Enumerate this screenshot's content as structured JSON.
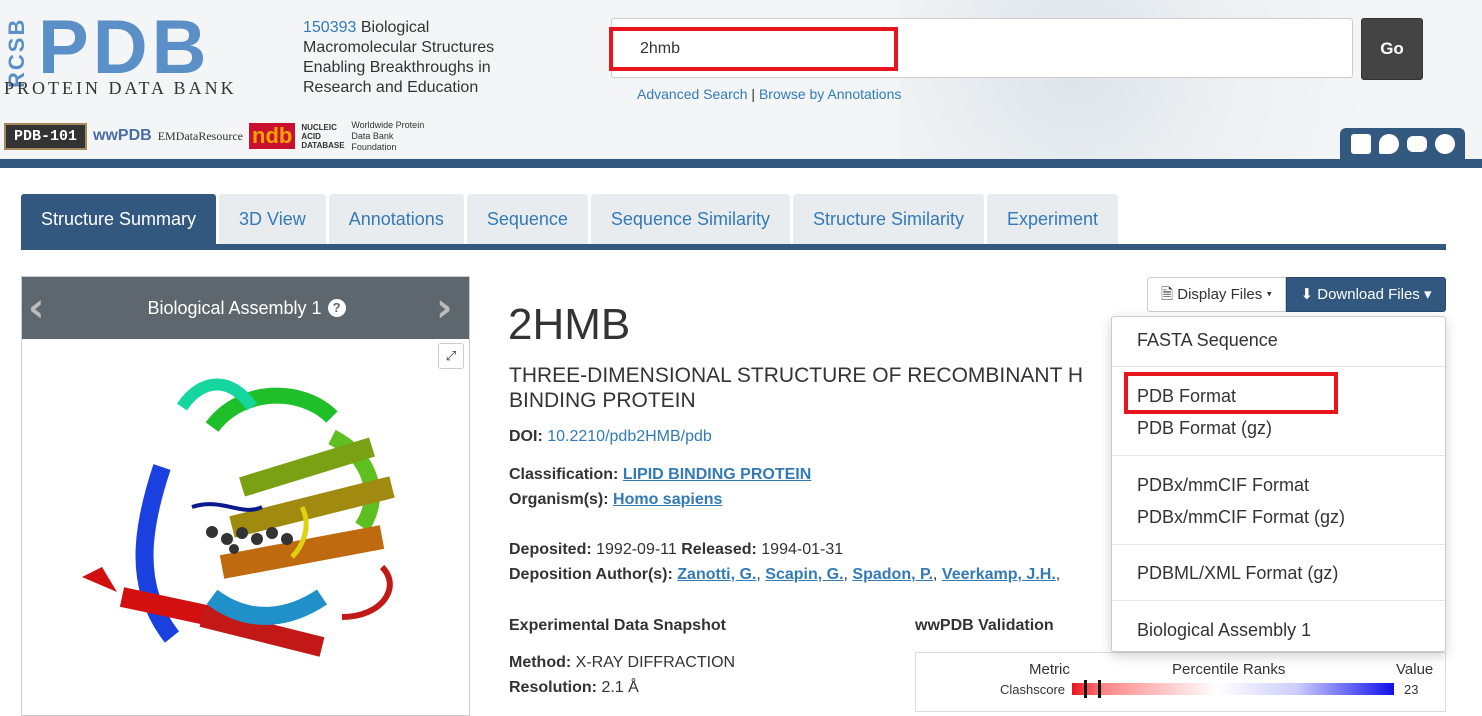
{
  "header": {
    "logo": {
      "rcsb": "RCSB",
      "pdb": "PDB",
      "subtitle": "PROTEIN DATA BANK"
    },
    "tagline": {
      "count": "150393",
      "text": " Biological Macromolecular Structures Enabling Breakthroughs in Research and Education"
    },
    "partners": {
      "pdb101": "PDB-101",
      "wwpdb": "wwPDB",
      "emdb": "EMDataResource",
      "ndb": "ndb",
      "ndb_text": "NUCLEIC ACID DATABASE",
      "foundation": "Worldwide Protein Data Bank Foundation"
    }
  },
  "search": {
    "value": "2hmb",
    "go_label": "Go",
    "advanced_label": "Advanced Search",
    "separator": " | ",
    "browse_label": "Browse by Annotations"
  },
  "social": [
    "facebook-icon",
    "twitter-icon",
    "youtube-icon",
    "github-icon"
  ],
  "tabs": [
    {
      "label": "Structure Summary",
      "active": true
    },
    {
      "label": "3D View"
    },
    {
      "label": "Annotations"
    },
    {
      "label": "Sequence"
    },
    {
      "label": "Sequence Similarity"
    },
    {
      "label": "Structure Similarity"
    },
    {
      "label": "Experiment"
    }
  ],
  "viewer": {
    "title": "Biological Assembly 1",
    "help": "?"
  },
  "entry": {
    "id": "2HMB",
    "title": "THREE-DIMENSIONAL STRUCTURE OF RECOMBINANT H\nBINDING PROTEIN",
    "doi_label": "DOI:",
    "doi_value": "10.2210/pdb2HMB/pdb",
    "classification_label": "Classification:",
    "classification_value": "LIPID BINDING PROTEIN",
    "organism_label": "Organism(s):",
    "organism_value": "Homo sapiens",
    "deposited_label": "Deposited:",
    "deposited_value": "1992-09-11",
    "released_label": "Released:",
    "released_value": "1994-01-31",
    "authors_label": "Deposition Author(s):",
    "authors": [
      "Zanotti, G.",
      "Scapin, G.",
      "Spadon, P.",
      "Veerkamp, J.H."
    ]
  },
  "snapshot": {
    "title": "Experimental Data Snapshot",
    "method_label": "Method:",
    "method_value": "X-RAY DIFFRACTION",
    "resolution_label": "Resolution:",
    "resolution_value": "2.1 Å"
  },
  "validation": {
    "title": "wwPDB Validation",
    "col_metric": "Metric",
    "col_percentile": "Percentile Ranks",
    "col_value": "Value",
    "metric_name": "Clashscore",
    "metric_value": "23"
  },
  "files": {
    "display_label": "Display Files",
    "download_label": "Download Files",
    "menu": [
      "FASTA Sequence",
      "PDB Format",
      "PDB Format (gz)",
      "PDBx/mmCIF Format",
      "PDBx/mmCIF Format (gz)",
      "PDBML/XML Format (gz)",
      "Biological Assembly 1"
    ]
  },
  "colors": {
    "brand": "#325880",
    "link": "#337ab7",
    "highlight": "#e8141e",
    "header_bg": "#f3f5f6"
  }
}
